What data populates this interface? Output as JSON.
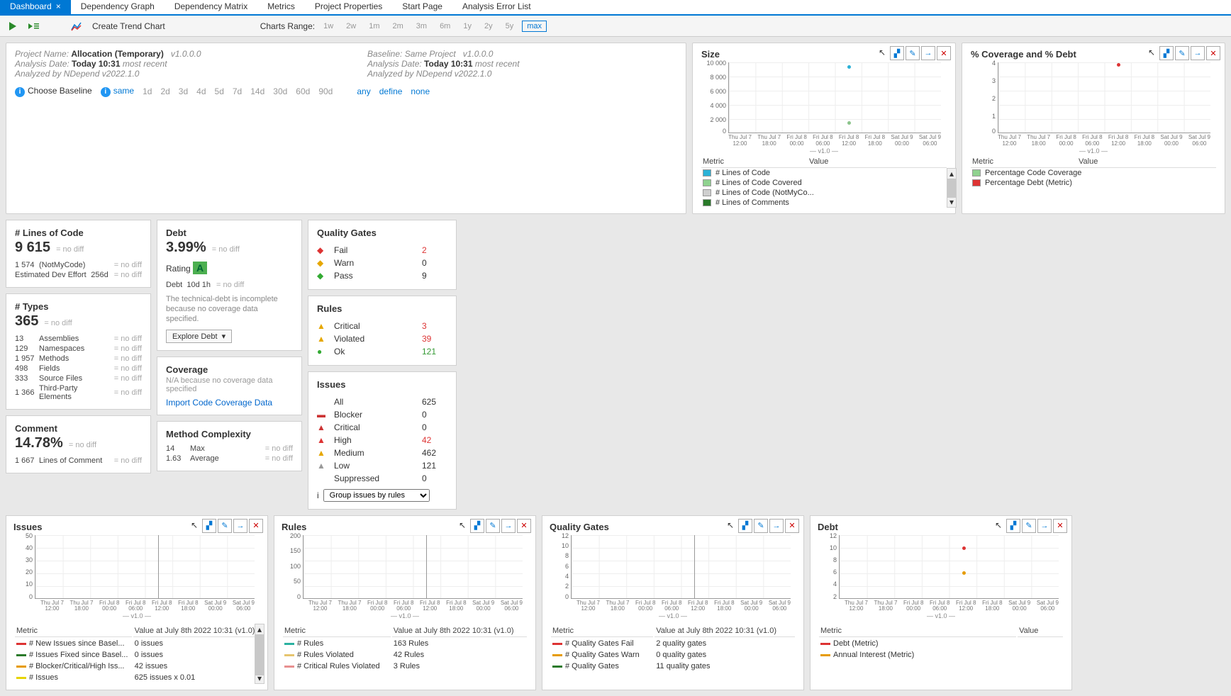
{
  "tabs": [
    "Dashboard",
    "Dependency Graph",
    "Dependency Matrix",
    "Metrics",
    "Project Properties",
    "Start Page",
    "Analysis Error List"
  ],
  "active_tab": "Dashboard",
  "toolbar": {
    "create_trend": "Create Trend Chart",
    "charts_range_label": "Charts Range:",
    "ranges": [
      "1w",
      "2w",
      "1m",
      "2m",
      "3m",
      "6m",
      "1y",
      "2y",
      "5y",
      "max"
    ],
    "range_sel": "max"
  },
  "header": {
    "left": {
      "project_label": "Project Name:",
      "project": "Allocation (Temporary)",
      "ver": "v1.0.0.0",
      "analysis_label": "Analysis Date:",
      "analysis": "Today 10:31",
      "recent": "most recent",
      "analyzed": "Analyzed by NDepend v2022.1.0"
    },
    "right": {
      "baseline_label": "Baseline:",
      "baseline": "Same Project",
      "ver": "v1.0.0.0",
      "analysis_label": "Analysis Date:",
      "analysis": "Today 10:31",
      "recent": "most recent",
      "analyzed": "Analyzed by NDepend v2022.1.0"
    },
    "choose": "Choose Baseline",
    "pills": [
      "same",
      "1d",
      "2d",
      "3d",
      "4d",
      "5d",
      "7d",
      "14d",
      "30d",
      "60d",
      "90d"
    ],
    "extra": [
      "any",
      "define",
      "none"
    ]
  },
  "size_chart": {
    "title": "Size",
    "yticks": [
      "10 000",
      "8 000",
      "6 000",
      "4 000",
      "2 000",
      "0"
    ],
    "xticks": [
      "Thu Jul 7\n12:00",
      "Thu Jul 7\n18:00",
      "Fri Jul 8\n00:00",
      "Fri Jul 8\n06:00",
      "Fri Jul 8\n12:00",
      "Fri Jul 8\n18:00",
      "Sat Jul 9\n00:00",
      "Sat Jul 9\n06:00"
    ],
    "legend_hdr": [
      "Metric",
      "Value"
    ],
    "legend": [
      {
        "c": "#2bb1d6",
        "t": "# Lines of Code"
      },
      {
        "c": "#8fd28f",
        "t": "# Lines of Code Covered"
      },
      {
        "c": "#cfcfcf",
        "t": "# Lines of Code (NotMyCo..."
      },
      {
        "c": "#2a7a2a",
        "t": "# Lines of Comments"
      }
    ]
  },
  "cov_chart": {
    "title": "% Coverage and % Debt",
    "yticks": [
      "4",
      "3",
      "2",
      "1",
      "0"
    ],
    "legend": [
      {
        "c": "#8fd28f",
        "t": "Percentage Code Coverage"
      },
      {
        "c": "#d33",
        "t": "Percentage Debt (Metric)"
      }
    ]
  },
  "loc": {
    "title": "# Lines of Code",
    "value": "9 615",
    "rows": [
      [
        "1 574",
        "(NotMyCode)"
      ],
      [
        "Estimated Dev Effort",
        "256d"
      ]
    ]
  },
  "types": {
    "title": "# Types",
    "value": "365",
    "rows": [
      [
        "13",
        "Assemblies"
      ],
      [
        "129",
        "Namespaces"
      ],
      [
        "1 957",
        "Methods"
      ],
      [
        "498",
        "Fields"
      ],
      [
        "333",
        "Source Files"
      ],
      [
        "1 366",
        "Third-Party Elements"
      ]
    ]
  },
  "comment": {
    "title": "Comment",
    "value": "14.78%",
    "rows": [
      [
        "1 667",
        "Lines of Comment"
      ]
    ]
  },
  "debt": {
    "title": "Debt",
    "value": "3.99%",
    "rating_label": "Rating",
    "rating": "A",
    "debt_row": [
      "Debt",
      "10d 1h"
    ],
    "desc": "The technical-debt is incomplete because no coverage data specified.",
    "explore": "Explore Debt"
  },
  "coverage": {
    "title": "Coverage",
    "desc": "N/A because no coverage data specified",
    "link": "Import Code Coverage Data"
  },
  "complexity": {
    "title": "Method Complexity",
    "rows": [
      [
        "14",
        "Max"
      ],
      [
        "1.63",
        "Average"
      ]
    ]
  },
  "qg": {
    "title": "Quality Gates",
    "rows": [
      {
        "ic": "fail",
        "lbl": "Fail",
        "val": "2",
        "cl": "#d33"
      },
      {
        "ic": "warn",
        "lbl": "Warn",
        "val": "0",
        "cl": "#333"
      },
      {
        "ic": "pass",
        "lbl": "Pass",
        "val": "9",
        "cl": "#333"
      }
    ]
  },
  "rules": {
    "title": "Rules",
    "rows": [
      {
        "ic": "crit",
        "lbl": "Critical",
        "val": "3",
        "cl": "#d33"
      },
      {
        "ic": "viol",
        "lbl": "Violated",
        "val": "39",
        "cl": "#d33"
      },
      {
        "ic": "ok",
        "lbl": "Ok",
        "val": "121",
        "cl": "#393"
      }
    ]
  },
  "issues": {
    "title": "Issues",
    "rows": [
      {
        "ic": "",
        "lbl": "All",
        "val": "625",
        "cl": "#333"
      },
      {
        "ic": "blocker",
        "lbl": "Blocker",
        "val": "0",
        "cl": "#333"
      },
      {
        "ic": "critical",
        "lbl": "Critical",
        "val": "0",
        "cl": "#333"
      },
      {
        "ic": "high",
        "lbl": "High",
        "val": "42",
        "cl": "#d33"
      },
      {
        "ic": "medium",
        "lbl": "Medium",
        "val": "462",
        "cl": "#333"
      },
      {
        "ic": "low",
        "lbl": "Low",
        "val": "121",
        "cl": "#333"
      },
      {
        "ic": "",
        "lbl": "Suppressed",
        "val": "0",
        "cl": "#333"
      }
    ],
    "group": "Group issues by rules"
  },
  "bottom_xticks": [
    "Thu Jul 7\n12:00",
    "Thu Jul 7\n18:00",
    "Fri Jul 8\n00:00",
    "Fri Jul 8\n06:00",
    "Fri Jul 8\n12:00",
    "Fri Jul 8\n18:00",
    "Sat Jul 9\n00:00",
    "Sat Jul 9\n06:00"
  ],
  "bottom": [
    {
      "title": "Issues",
      "yticks": [
        "50",
        "40",
        "30",
        "20",
        "10",
        "0"
      ],
      "value_hdr": "Value at July 8th 2022  10:31  (v1.0)",
      "legend": [
        {
          "c": "#d33",
          "t": "# New Issues since Basel...",
          "v": "0 issues"
        },
        {
          "c": "#2a7a2a",
          "t": "# Issues Fixed since Basel...",
          "v": "0 issues"
        },
        {
          "c": "#e69b00",
          "t": "# Blocker/Critical/High Iss...",
          "v": "42 issues"
        },
        {
          "c": "#e6d400",
          "t": "# Issues",
          "v": "625 issues   x 0.01"
        }
      ]
    },
    {
      "title": "Rules",
      "yticks": [
        "200",
        "150",
        "100",
        "50",
        "0"
      ],
      "value_hdr": "Value at July 8th 2022  10:31  (v1.0)",
      "legend": [
        {
          "c": "#2bb1a0",
          "t": "# Rules",
          "v": "163 Rules"
        },
        {
          "c": "#e6c46e",
          "t": "# Rules Violated",
          "v": "42 Rules"
        },
        {
          "c": "#e89090",
          "t": "# Critical Rules Violated",
          "v": "3 Rules"
        }
      ]
    },
    {
      "title": "Quality Gates",
      "yticks": [
        "12",
        "10",
        "8",
        "6",
        "4",
        "2",
        "0"
      ],
      "value_hdr": "Value at July 8th 2022  10:31  (v1.0)",
      "legend": [
        {
          "c": "#d33",
          "t": "# Quality Gates Fail",
          "v": "2 quality gates"
        },
        {
          "c": "#e69b00",
          "t": "# Quality Gates Warn",
          "v": "0 quality gates"
        },
        {
          "c": "#2a7a2a",
          "t": "# Quality Gates",
          "v": "11 quality gates"
        }
      ]
    },
    {
      "title": "Debt",
      "yticks": [
        "12",
        "10",
        "8",
        "6",
        "4",
        "2"
      ],
      "value_hdr": "Value",
      "legend": [
        {
          "c": "#d33",
          "t": "Debt (Metric)",
          "v": ""
        },
        {
          "c": "#e69b00",
          "t": "Annual Interest (Metric)",
          "v": ""
        }
      ]
    }
  ],
  "nodiff": "= no diff",
  "metric_label": "Metric",
  "chart_data": {
    "size": {
      "type": "scatter",
      "series": [
        {
          "name": "# Lines of Code",
          "points": [
            {
              "x": "Fri Jul 8 12:00",
              "y": 9615
            }
          ]
        },
        {
          "name": "# Lines of Code (NotMyCode)",
          "points": [
            {
              "x": "Fri Jul 8 12:00",
              "y": 1574
            }
          ]
        }
      ],
      "ylim": [
        0,
        10000
      ]
    },
    "coverage_debt": {
      "type": "scatter",
      "series": [
        {
          "name": "Percentage Debt (Metric)",
          "points": [
            {
              "x": "Fri Jul 8 12:00",
              "y": 3.99
            }
          ]
        }
      ],
      "ylim": [
        0,
        4
      ]
    },
    "issues_trend": {
      "type": "line",
      "ylim": [
        0,
        50
      ]
    },
    "rules_trend": {
      "type": "line",
      "ylim": [
        0,
        200
      ]
    },
    "qg_trend": {
      "type": "line",
      "ylim": [
        0,
        12
      ]
    },
    "debt_trend": {
      "type": "scatter",
      "series": [
        {
          "name": "Debt",
          "points": [
            {
              "x": "Fri Jul 8 12:00",
              "y": 10
            }
          ]
        },
        {
          "name": "Annual Interest",
          "points": [
            {
              "x": "Fri Jul 8 12:00",
              "y": 6
            }
          ]
        }
      ],
      "ylim": [
        2,
        12
      ]
    }
  }
}
